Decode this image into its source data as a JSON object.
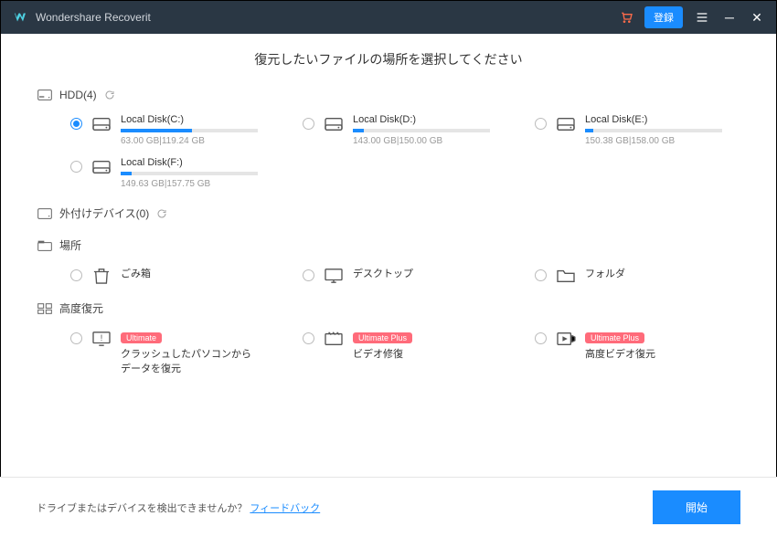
{
  "app": {
    "title": "Wondershare Recoverit",
    "register": "登録"
  },
  "page_title": "復元したいファイルの場所を選択してください",
  "sections": {
    "hdd": {
      "label": "HDD(4)"
    },
    "external": {
      "label": "外付けデバイス(0)"
    },
    "places": {
      "label": "場所"
    },
    "advanced": {
      "label": "高度復元"
    }
  },
  "disks": [
    {
      "label": "Local Disk(C:)",
      "meta": "63.00 GB|119.24 GB",
      "fill": 52,
      "selected": true
    },
    {
      "label": "Local Disk(D:)",
      "meta": "143.00 GB|150.00 GB",
      "fill": 8,
      "selected": false
    },
    {
      "label": "Local Disk(E:)",
      "meta": "150.38 GB|158.00 GB",
      "fill": 6,
      "selected": false
    },
    {
      "label": "Local Disk(F:)",
      "meta": "149.63 GB|157.75 GB",
      "fill": 8,
      "selected": false
    }
  ],
  "places": [
    {
      "label": "ごみ箱"
    },
    {
      "label": "デスクトップ"
    },
    {
      "label": "フォルダ"
    }
  ],
  "advanced": [
    {
      "label": "クラッシュしたパソコンからデータを復元",
      "badge": "Ultimate"
    },
    {
      "label": "ビデオ修復",
      "badge": "Ultimate Plus"
    },
    {
      "label": "高度ビデオ復元",
      "badge": "Ultimate Plus"
    }
  ],
  "footer": {
    "prompt": "ドライブまたはデバイスを検出できませんか？",
    "feedback": "フィードバック",
    "start": "開始"
  }
}
